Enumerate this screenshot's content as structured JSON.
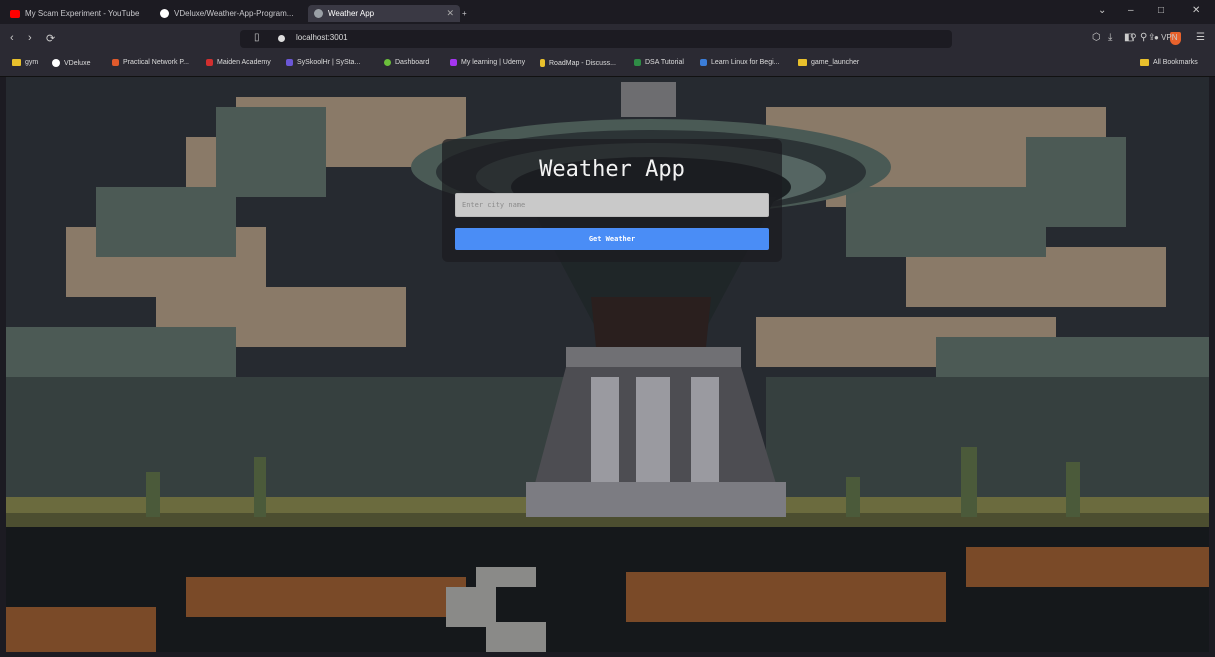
{
  "browser": {
    "tabs": [
      {
        "label": "My Scam Experiment - YouTube",
        "favicon_color": "#ff0000"
      },
      {
        "label": "VDeluxe/Weather-App-Program...",
        "favicon_color": "#ffffff"
      },
      {
        "label": "Weather App",
        "favicon_color": "#9aa0a6"
      }
    ],
    "new_tab_label": "+",
    "window_controls": [
      "⌄",
      "–",
      "□",
      "✕"
    ],
    "address": "localhost:3001",
    "bookmarks": [
      {
        "label": "gym",
        "type": "folder"
      },
      {
        "label": "VDeluxe",
        "type": "site",
        "color": "#ffffff"
      },
      {
        "label": "Practical Network P...",
        "type": "site",
        "color": "#e05a2c"
      },
      {
        "label": "Maiden Academy",
        "type": "site",
        "color": "#d22f2f"
      },
      {
        "label": "SySkoolHr | SySta...",
        "type": "site",
        "color": "#6b57d6"
      },
      {
        "label": "Dashboard",
        "type": "site",
        "color": "#6bbf3b"
      },
      {
        "label": "My learning | Udemy",
        "type": "site",
        "color": "#a435f0"
      },
      {
        "label": "RoadMap - Discuss...",
        "type": "site",
        "color": "#e8c02c"
      },
      {
        "label": "DSA Tutorial",
        "type": "site",
        "color": "#2f8d46"
      },
      {
        "label": "Learn Linux for Begi...",
        "type": "site",
        "color": "#3b7dd8"
      },
      {
        "label": "game_launcher",
        "type": "folder"
      }
    ],
    "all_bookmarks_label": "All Bookmarks",
    "vpn_label": "VPN"
  },
  "app": {
    "title": "Weather App",
    "city_input": {
      "placeholder": "Enter city name",
      "value": ""
    },
    "button_label": "Get Weather",
    "accent_color": "#4a8df6"
  }
}
